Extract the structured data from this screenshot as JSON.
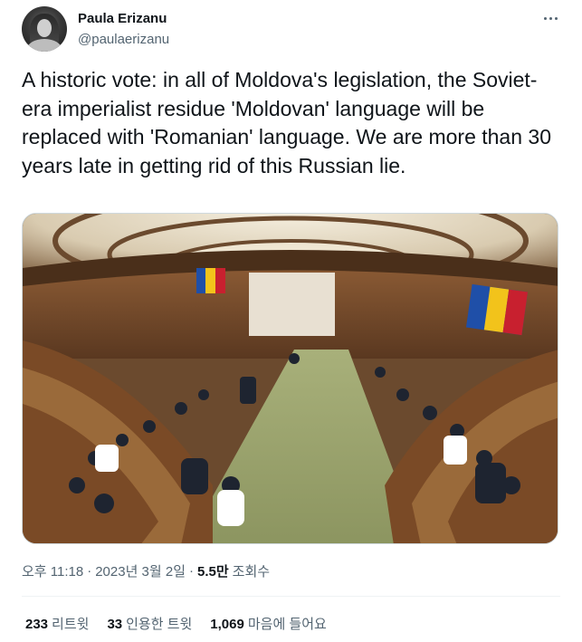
{
  "author": {
    "display_name": "Paula Erizanu",
    "handle": "@paulaerizanu"
  },
  "tweet": {
    "text": "A historic vote: in all of Moldova's legislation, the Soviet-era imperialist residue 'Moldovan' language will be replaced with 'Romanian' language. We are more than 30 years late in getting rid of this Russian lie."
  },
  "meta": {
    "time": "오후 11:18",
    "separator": "·",
    "date": "2023년 3월 2일",
    "views_count": "5.5만",
    "views_label": "조회수"
  },
  "stats": {
    "retweets_count": "233",
    "retweets_label": "리트윗",
    "quotes_count": "33",
    "quotes_label": "인용한 트윗",
    "likes_count": "1,069",
    "likes_label": "마음에 들어요"
  },
  "icons": {
    "more": "more-horizontal-icon"
  },
  "colors": {
    "text_primary": "#0f1419",
    "text_secondary": "#536471",
    "divider": "#eff3f4"
  }
}
